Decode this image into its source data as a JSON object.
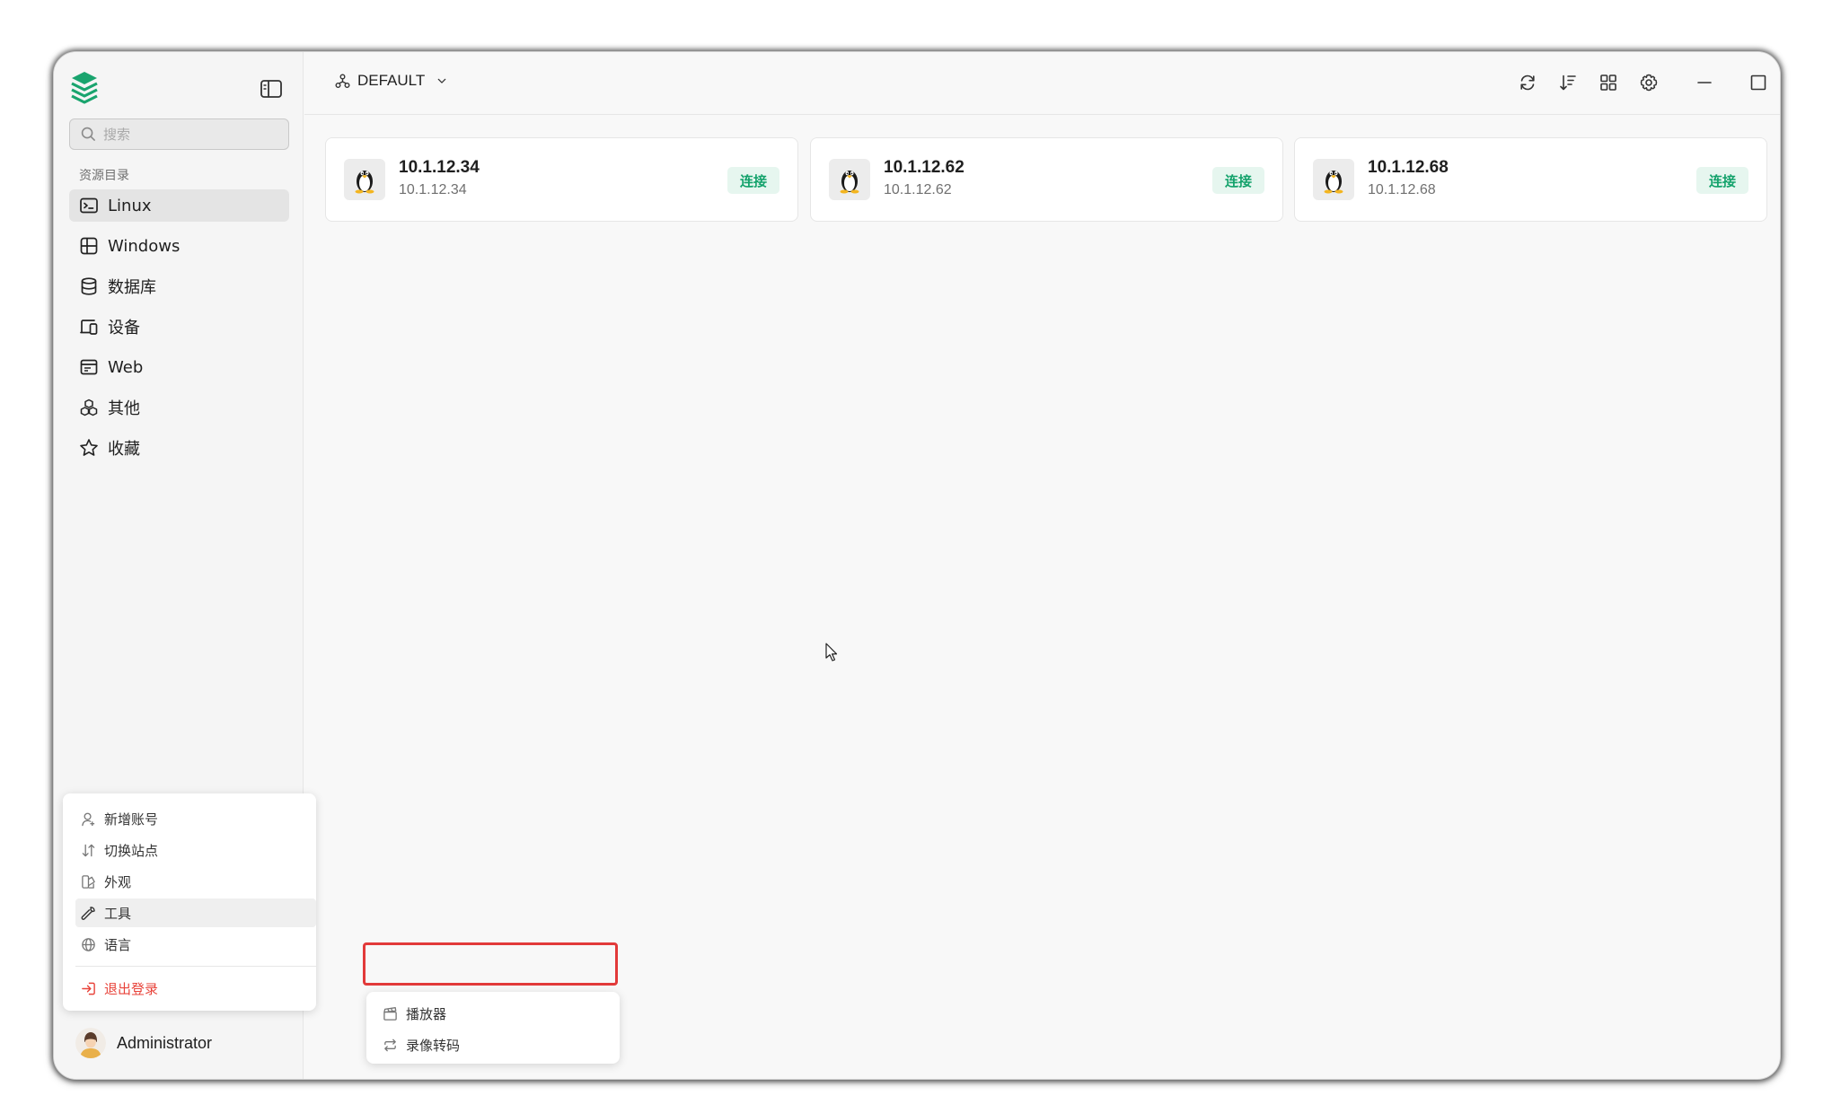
{
  "app": {
    "workspace_label": "DEFAULT"
  },
  "sidebar": {
    "search_placeholder": "搜索",
    "section_title": "资源目录",
    "items": [
      {
        "label": "Linux",
        "icon": "terminal-icon",
        "active": true
      },
      {
        "label": "Windows",
        "icon": "windows-icon"
      },
      {
        "label": "数据库",
        "icon": "database-icon"
      },
      {
        "label": "设备",
        "icon": "devices-icon"
      },
      {
        "label": "Web",
        "icon": "browser-icon"
      },
      {
        "label": "其他",
        "icon": "boxes-icon"
      },
      {
        "label": "收藏",
        "icon": "star-icon"
      }
    ]
  },
  "user_menu": {
    "items": [
      {
        "label": "新增账号",
        "icon": "user-add-icon"
      },
      {
        "label": "切换站点",
        "icon": "switch-icon"
      },
      {
        "label": "外观",
        "icon": "palette-icon"
      },
      {
        "label": "工具",
        "icon": "wrench-icon",
        "hover": true
      },
      {
        "label": "语言",
        "icon": "globe-icon"
      }
    ],
    "logout_label": "退出登录"
  },
  "tools_submenu": {
    "items": [
      {
        "label": "播放器",
        "icon": "clapperboard-icon",
        "highlighted": true
      },
      {
        "label": "录像转码",
        "icon": "repeat-icon"
      }
    ]
  },
  "user": {
    "name": "Administrator"
  },
  "hosts": [
    {
      "title": "10.1.12.34",
      "address": "10.1.12.34",
      "connect_label": "连接",
      "os_icon": "linux-penguin-icon"
    },
    {
      "title": "10.1.12.62",
      "address": "10.1.12.62",
      "connect_label": "连接",
      "os_icon": "linux-penguin-icon"
    },
    {
      "title": "10.1.12.68",
      "address": "10.1.12.68",
      "connect_label": "连接",
      "os_icon": "linux-penguin-icon"
    }
  ],
  "colors": {
    "accent_green": "#13a26b",
    "connect_bg": "#e6f6ef",
    "danger": "#e8433a",
    "highlight_box": "#e23a3a"
  }
}
